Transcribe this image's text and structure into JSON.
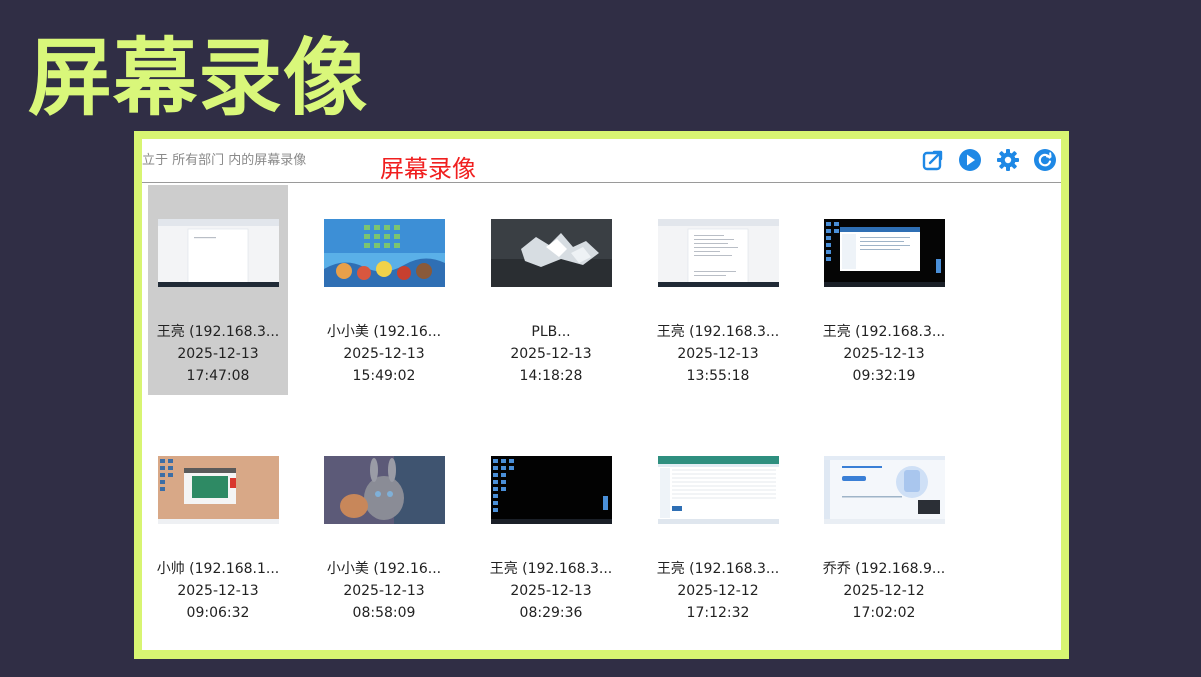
{
  "slide": {
    "title": "屏幕录像"
  },
  "toolbar": {
    "scope_text": "立于 所有部门 内的屏幕录像",
    "caption": "屏幕录像",
    "icons": [
      "export-icon",
      "play-icon",
      "gear-icon",
      "refresh-icon"
    ]
  },
  "colors": {
    "background": "#302e45",
    "accent": "#d8f572",
    "caption": "#f01f1f",
    "icon": "#1e88e5",
    "selected": "#cdcdcd"
  },
  "recordings": [
    {
      "name": "王亮 (192.168.3...",
      "date": "2025-12-13",
      "time": "17:47:08",
      "selected": true
    },
    {
      "name": "小小美 (192.16...",
      "date": "2025-12-13",
      "time": "15:49:02"
    },
    {
      "name": "PLB...",
      "date": "2025-12-13",
      "time": "14:18:28"
    },
    {
      "name": "王亮 (192.168.3...",
      "date": "2025-12-13",
      "time": "13:55:18"
    },
    {
      "name": "王亮 (192.168.3...",
      "date": "2025-12-13",
      "time": "09:32:19"
    },
    {
      "name": "小帅 (192.168.1...",
      "date": "2025-12-13",
      "time": "09:06:32"
    },
    {
      "name": "小小美 (192.16...",
      "date": "2025-12-13",
      "time": "08:58:09"
    },
    {
      "name": "王亮 (192.168.3...",
      "date": "2025-12-13",
      "time": "08:29:36"
    },
    {
      "name": "王亮 (192.168.3...",
      "date": "2025-12-12",
      "time": "17:12:32"
    },
    {
      "name": "乔乔 (192.168.9...",
      "date": "2025-12-12",
      "time": "17:02:02"
    }
  ]
}
